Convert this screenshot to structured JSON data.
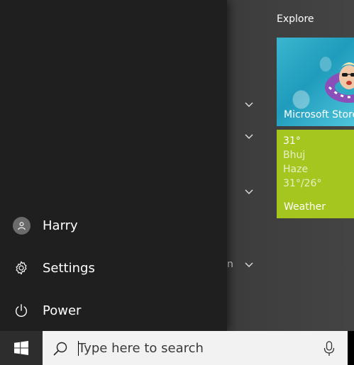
{
  "user": {
    "name": "Harry"
  },
  "rail": {
    "settings_label": "Settings",
    "power_label": "Power"
  },
  "apps_list": {
    "partial_text": "n"
  },
  "tiles": {
    "section_title": "Explore",
    "store": {
      "label": "Microsoft Store"
    },
    "weather": {
      "temperature": "31°",
      "city": "Bhuj",
      "condition": "Haze",
      "range": "31°/26°",
      "label": "Weather"
    }
  },
  "taskbar": {
    "search_placeholder": "Type here to search"
  },
  "colors": {
    "weather_tile": "#a4c61e",
    "rail_bg": "#1f1f1f",
    "taskbar_bg": "#1b1b1b",
    "search_bg": "#f2f2f2"
  }
}
